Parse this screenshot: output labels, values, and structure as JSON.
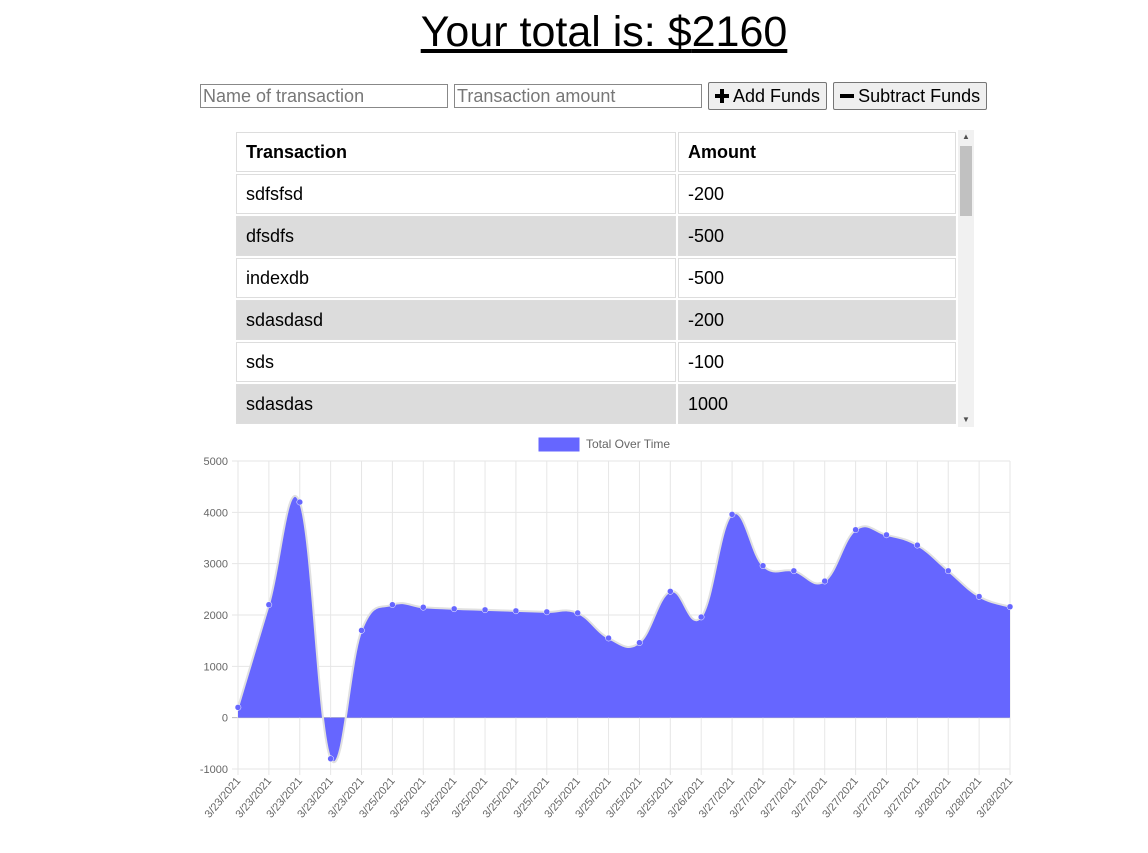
{
  "header": {
    "total_label": "Your total is: $",
    "total_value": "2160"
  },
  "form": {
    "name_placeholder": "Name of transaction",
    "amount_placeholder": "Transaction amount",
    "add_label": "Add Funds",
    "subtract_label": "Subtract Funds"
  },
  "table": {
    "headers": [
      "Transaction",
      "Amount"
    ],
    "rows": [
      {
        "name": "sdfsfsd",
        "amount": "-200"
      },
      {
        "name": "dfsdfs",
        "amount": "-500"
      },
      {
        "name": "indexdb",
        "amount": "-500"
      },
      {
        "name": "sdasdasd",
        "amount": "-200"
      },
      {
        "name": "sds",
        "amount": "-100"
      },
      {
        "name": "sdasdas",
        "amount": "1000"
      }
    ]
  },
  "chart_data": {
    "type": "area",
    "legend": "Total Over Time",
    "color": "#6666ff",
    "x": [
      "3/23/2021",
      "3/23/2021",
      "3/23/2021",
      "3/23/2021",
      "3/23/2021",
      "3/25/2021",
      "3/25/2021",
      "3/25/2021",
      "3/25/2021",
      "3/25/2021",
      "3/25/2021",
      "3/25/2021",
      "3/25/2021",
      "3/25/2021",
      "3/25/2021",
      "3/26/2021",
      "3/27/2021",
      "3/27/2021",
      "3/27/2021",
      "3/27/2021",
      "3/27/2021",
      "3/27/2021",
      "3/27/2021",
      "3/28/2021",
      "3/28/2021",
      "3/28/2021"
    ],
    "values": [
      200,
      2200,
      4200,
      -800,
      1700,
      2200,
      2150,
      2120,
      2100,
      2080,
      2060,
      2040,
      1550,
      1460,
      2460,
      1960,
      3960,
      2960,
      2860,
      2660,
      3660,
      3560,
      3360,
      2860,
      2360,
      2160
    ],
    "ylim": [
      -1000,
      5000
    ],
    "yticks": [
      5000,
      4000,
      3000,
      2000,
      1000,
      0,
      -1000
    ],
    "grid": true,
    "legend_position": "top"
  }
}
